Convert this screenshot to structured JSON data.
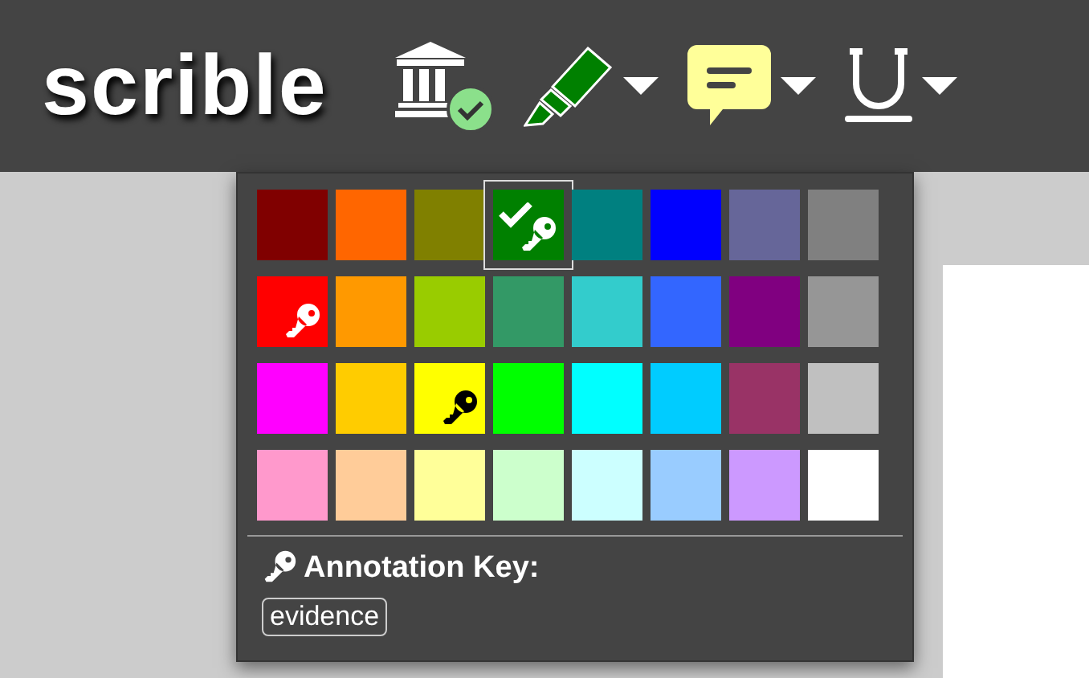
{
  "toolbar": {
    "logo": "scrible",
    "tools": [
      {
        "kind": "library",
        "verified": true,
        "dropdown": false
      },
      {
        "kind": "highlighter",
        "dropdown": true
      },
      {
        "kind": "comment",
        "dropdown": true
      },
      {
        "kind": "underline",
        "dropdown": true
      }
    ]
  },
  "color_menu": {
    "palette_rows": [
      {
        "swatches": [
          {
            "color": "#800000",
            "selected": false,
            "keyed": false
          },
          {
            "color": "#ff6600",
            "selected": false,
            "keyed": false
          },
          {
            "color": "#808000",
            "selected": false,
            "keyed": false
          },
          {
            "color": "#008000",
            "selected": true,
            "keyed": true
          },
          {
            "color": "#008080",
            "selected": false,
            "keyed": false
          },
          {
            "color": "#0000ff",
            "selected": false,
            "keyed": false
          },
          {
            "color": "#666699",
            "selected": false,
            "keyed": false
          },
          {
            "color": "#808080",
            "selected": false,
            "keyed": false
          }
        ]
      },
      {
        "swatches": [
          {
            "color": "#ff0000",
            "selected": false,
            "keyed": true
          },
          {
            "color": "#ff9900",
            "selected": false,
            "keyed": false
          },
          {
            "color": "#99cc00",
            "selected": false,
            "keyed": false
          },
          {
            "color": "#339966",
            "selected": false,
            "keyed": false
          },
          {
            "color": "#33cccc",
            "selected": false,
            "keyed": false
          },
          {
            "color": "#3366ff",
            "selected": false,
            "keyed": false
          },
          {
            "color": "#800080",
            "selected": false,
            "keyed": false
          },
          {
            "color": "#969696",
            "selected": false,
            "keyed": false
          }
        ]
      },
      {
        "swatches": [
          {
            "color": "#ff00ff",
            "selected": false,
            "keyed": false
          },
          {
            "color": "#ffcc00",
            "selected": false,
            "keyed": false
          },
          {
            "color": "#ffff00",
            "selected": false,
            "keyed": true
          },
          {
            "color": "#00ff00",
            "selected": false,
            "keyed": false
          },
          {
            "color": "#00ffff",
            "selected": false,
            "keyed": false
          },
          {
            "color": "#00ccff",
            "selected": false,
            "keyed": false
          },
          {
            "color": "#993366",
            "selected": false,
            "keyed": false
          },
          {
            "color": "#c0c0c0",
            "selected": false,
            "keyed": false
          }
        ]
      },
      {
        "swatches": [
          {
            "color": "#ff99cc",
            "selected": false,
            "keyed": false
          },
          {
            "color": "#ffcc99",
            "selected": false,
            "keyed": false
          },
          {
            "color": "#ffff99",
            "selected": false,
            "keyed": false
          },
          {
            "color": "#ccffcc",
            "selected": false,
            "keyed": false
          },
          {
            "color": "#ccffff",
            "selected": false,
            "keyed": false
          },
          {
            "color": "#99ccff",
            "selected": false,
            "keyed": false
          },
          {
            "color": "#cc99ff",
            "selected": false,
            "keyed": false
          },
          {
            "color": "#ffffff",
            "selected": false,
            "keyed": false
          }
        ]
      }
    ],
    "key_heading": "Annotation Key:",
    "key_tags": [
      "evidence"
    ]
  }
}
